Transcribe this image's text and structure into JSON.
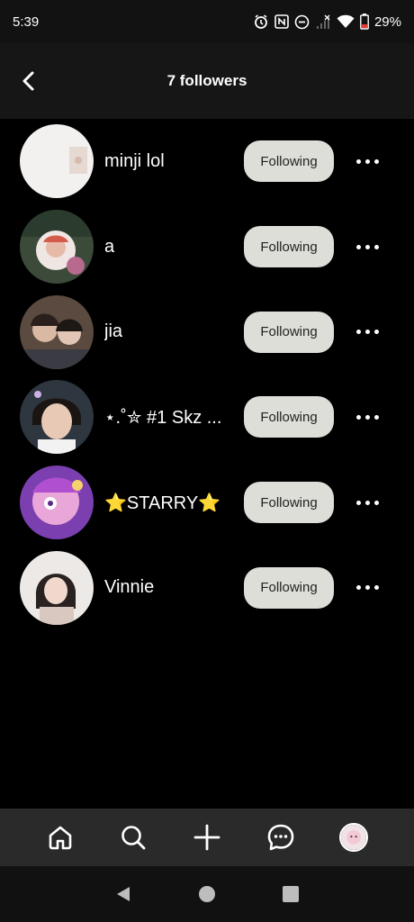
{
  "status": {
    "time": "5:39",
    "battery": "29%"
  },
  "header": {
    "title": "7 followers"
  },
  "followers": [
    {
      "username": "minji lol",
      "button": "Following"
    },
    {
      "username": "a",
      "button": "Following"
    },
    {
      "username": "jia",
      "button": "Following"
    },
    {
      "username": "⋆.˚✮ #1 Skz ...",
      "button": "Following"
    },
    {
      "username": "⭐STARRY⭐",
      "button": "Following"
    },
    {
      "username": "Vinnie",
      "button": "Following"
    }
  ],
  "bottom_nav": [
    "home-icon",
    "search-icon",
    "create-icon",
    "messages-icon",
    "profile-avatar"
  ],
  "colors": {
    "background": "#000000",
    "button_bg": "#deded8",
    "button_text": "#222222",
    "nav_bg": "#2a2a2a"
  }
}
